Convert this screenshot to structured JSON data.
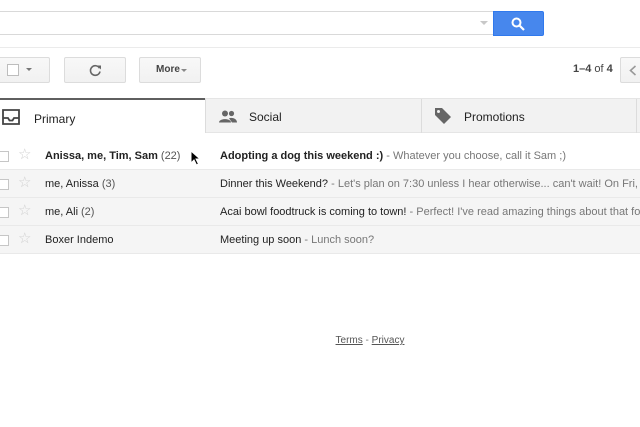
{
  "search": {
    "placeholder": "",
    "button_icon": "search-icon",
    "accent": "#4787ed"
  },
  "toolbar": {
    "more_label": "More",
    "pager": {
      "range": "1–4",
      "of_label": "of",
      "total": "4"
    }
  },
  "tabs": [
    {
      "label": "Primary",
      "icon": "inbox-icon",
      "active": true
    },
    {
      "label": "Social",
      "icon": "people-icon",
      "active": false
    },
    {
      "label": "Promotions",
      "icon": "tag-icon",
      "active": false
    }
  ],
  "emails": [
    {
      "sender": "Anissa, me, Tim, Sam",
      "count": "(22)",
      "subject": "Adopting a dog this weekend :)",
      "snippet": "Whatever you choose, call it Sam ;)",
      "unread": true
    },
    {
      "sender": "me, Anissa",
      "count": "(3)",
      "subject": "Dinner this Weekend?",
      "snippet": "Let's plan on 7:30 unless I hear otherwise... can't wait! On Fri, I",
      "unread": false
    },
    {
      "sender": "me, Ali",
      "count": "(2)",
      "subject": "Acai bowl foodtruck is coming to town!",
      "snippet": "Perfect! I've read amazing things about that foo",
      "unread": false
    },
    {
      "sender": "Boxer Indemo",
      "count": "",
      "subject": "Meeting up soon",
      "snippet": "Lunch soon?",
      "unread": false
    }
  ],
  "footer": {
    "terms": "Terms",
    "separator": "-",
    "privacy": "Privacy"
  }
}
